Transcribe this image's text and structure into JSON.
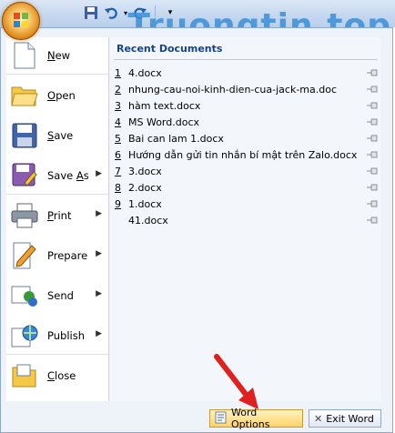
{
  "watermark": "Truongtin.top",
  "colors": {
    "accent": "#15428b",
    "menu_bg": "#eef3fa",
    "arrow": "#e02020",
    "options_bg": "#ffd36a"
  },
  "qat": {
    "items": [
      "save-icon",
      "undo-icon",
      "redo-icon",
      "customize-icon"
    ]
  },
  "left_menu": [
    {
      "label": "New",
      "mnemonic": "N",
      "icon": "new-document-icon",
      "has_arrow": false
    },
    {
      "label": "Open",
      "mnemonic": "O",
      "icon": "open-folder-icon",
      "has_arrow": false
    },
    {
      "label": "Save",
      "mnemonic": "S",
      "icon": "save-disk-icon",
      "has_arrow": false
    },
    {
      "label": "Save As",
      "mnemonic": "A",
      "icon": "save-as-icon",
      "has_arrow": true
    },
    {
      "label": "Print",
      "mnemonic": "P",
      "icon": "printer-icon",
      "has_arrow": true
    },
    {
      "label": "Prepare",
      "mnemonic": "E",
      "icon": "prepare-icon",
      "has_arrow": true
    },
    {
      "label": "Send",
      "mnemonic": "D",
      "icon": "send-icon",
      "has_arrow": true
    },
    {
      "label": "Publish",
      "mnemonic": "U",
      "icon": "publish-icon",
      "has_arrow": true
    },
    {
      "label": "Close",
      "mnemonic": "C",
      "icon": "close-folder-icon",
      "has_arrow": false
    }
  ],
  "recent": {
    "title": "Recent Documents",
    "documents": [
      {
        "num": "1",
        "name": "4.docx"
      },
      {
        "num": "2",
        "name": "nhung-cau-noi-kinh-dien-cua-jack-ma.doc"
      },
      {
        "num": "3",
        "name": "hàm text.docx"
      },
      {
        "num": "4",
        "name": "MS Word.docx"
      },
      {
        "num": "5",
        "name": "Bai can lam 1.docx"
      },
      {
        "num": "6",
        "name": "Hướng dẫn gửi tin nhắn bí mật trên Zalo.docx"
      },
      {
        "num": "7",
        "name": "3.docx"
      },
      {
        "num": "8",
        "name": "2.docx"
      },
      {
        "num": "9",
        "name": "1.docx"
      },
      {
        "num": "",
        "name": "41.docx"
      }
    ]
  },
  "buttons": {
    "word_options": "Word Options",
    "exit_word": "Exit Word"
  }
}
